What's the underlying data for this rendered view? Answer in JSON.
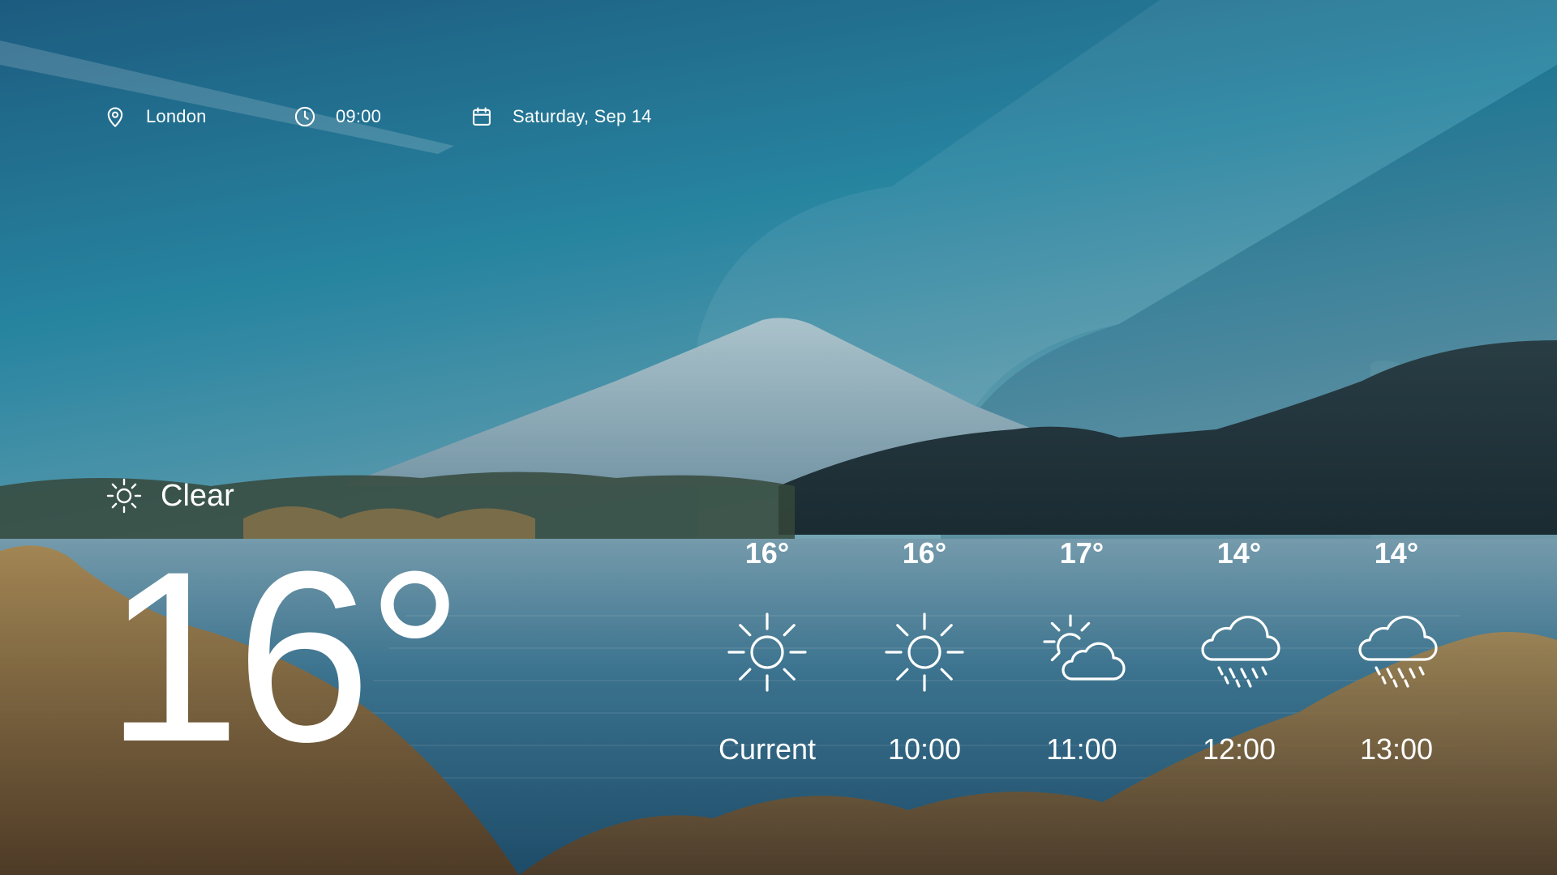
{
  "location": {
    "icon": "location-pin-icon",
    "text": "London"
  },
  "clock": {
    "icon": "clock-icon",
    "text": "09:00"
  },
  "date": {
    "icon": "calendar-icon",
    "text": "Saturday, Sep 14"
  },
  "current": {
    "condition_icon": "sun-icon",
    "condition": "Clear",
    "temperature": "16°"
  },
  "forecast": [
    {
      "temp": "16°",
      "icon": "sun-icon",
      "time": "Current"
    },
    {
      "temp": "16°",
      "icon": "sun-icon",
      "time": "10:00"
    },
    {
      "temp": "17°",
      "icon": "partly-cloudy-icon",
      "time": "11:00"
    },
    {
      "temp": "14°",
      "icon": "rain-cloud-icon",
      "time": "12:00"
    },
    {
      "temp": "14°",
      "icon": "rain-cloud-icon",
      "time": "13:00"
    }
  ],
  "colors": {
    "sky_top": "#1c5c82",
    "sky_mid": "#2a8aa6",
    "lake": "#2f6e8e",
    "foliage": "#b27b33",
    "text": "#ffffff"
  }
}
